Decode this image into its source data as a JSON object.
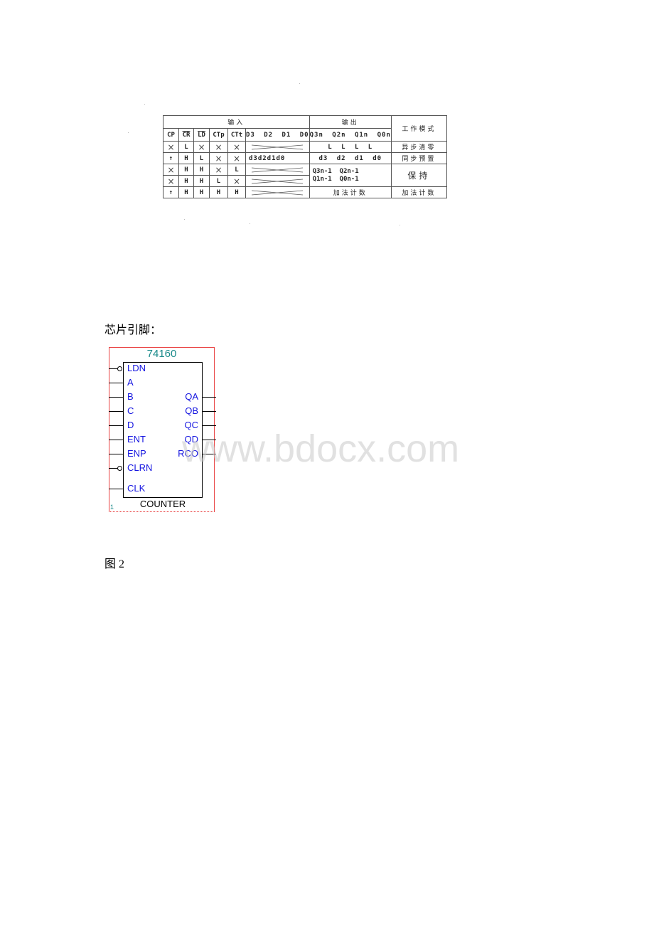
{
  "truth_table": {
    "group_headers": {
      "inputs": "输入",
      "outputs": "输出",
      "mode": "工作模式"
    },
    "column_headers": {
      "cp": "CP",
      "cr": "CR",
      "ld": "LD",
      "ctp": "CTp",
      "ctt": "CTt",
      "data": "D3  D2  D1  D0",
      "outputs": "Q3n Q2n Q1n Q0n"
    },
    "rows": [
      {
        "cp": "×",
        "cr": "L",
        "ld": "×",
        "ctp": "×",
        "ctt": "×",
        "data": "",
        "outputs": "L    L    L    L",
        "mode": "异步清零"
      },
      {
        "cp": "↑",
        "cr": "H",
        "ld": "L",
        "ctp": "×",
        "ctt": "×",
        "data": "d3d2d1d0",
        "outputs": "d3   d2   d1   d0",
        "mode": "同步预置"
      },
      {
        "cp": "×",
        "cr": "H",
        "ld": "H",
        "ctp": "×",
        "ctt": "L",
        "data": ""
      },
      {
        "cp": "×",
        "cr": "H",
        "ld": "H",
        "ctp": "L",
        "ctt": "×",
        "data": ""
      },
      {
        "cp": "↑",
        "cr": "H",
        "ld": "H",
        "ctp": "H",
        "ctt": "H",
        "data": "",
        "outputs": "加法计数",
        "mode": "加法计数"
      }
    ],
    "hold_outputs_line1": "Q3n-1  Q2n-1",
    "hold_outputs_line2": "Q1n-1  Q0n-1",
    "hold_mode": "保持"
  },
  "chip_section_label": "芯片引脚：",
  "chip": {
    "name": "74160",
    "type": "COUNTER",
    "instance_number": "1",
    "left_pins": [
      "LDN",
      "A",
      "B",
      "C",
      "D",
      "ENT",
      "ENP",
      "CLRN",
      "CLK"
    ],
    "right_pins": [
      "QA",
      "QB",
      "QC",
      "QD",
      "RCO"
    ],
    "colors": {
      "frame": "#e94444",
      "pin_label": "#1515e0",
      "name": "#1a8a8a"
    }
  },
  "figure_label": "图 2",
  "watermark": "www.bdocx.com"
}
